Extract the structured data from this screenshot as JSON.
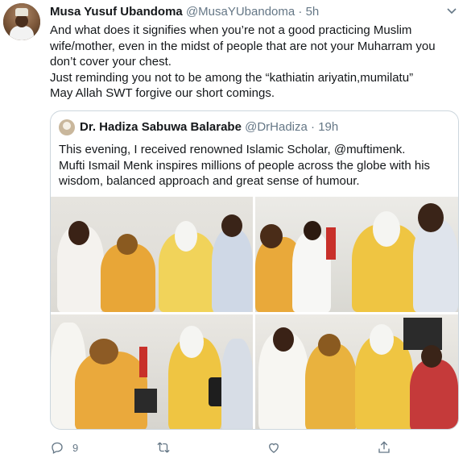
{
  "tweet": {
    "author_name": "Musa Yusuf Ubandoma",
    "handle": "@MusaYUbandoma",
    "separator": "·",
    "time": "5h",
    "body_lines": [
      "And what does it signifies when you’re not a good practicing Muslim",
      "wife/mother, even in the midst of people that are not your Muharram you",
      "don’t cover your chest.",
      "Just reminding you not to be among the “kathiatin ariyatin,mumilatu”",
      "May Allah SWT forgive our short comings."
    ]
  },
  "quoted": {
    "author_name": "Dr. Hadiza Sabuwa Balarabe",
    "handle": "@DrHadiza",
    "separator": "·",
    "time": "19h",
    "body_lines": [
      "This evening, I received renowned Islamic Scholar, @muftimenk.",
      "Mufti Ismail Menk inspires millions of people across the globe with his",
      "wisdom, balanced approach and great sense of humour."
    ]
  },
  "actions": {
    "reply_count": "9",
    "retweet_count": "",
    "like_count": ""
  },
  "icons": [
    "caret-down-icon",
    "reply-icon",
    "retweet-icon",
    "like-icon",
    "share-icon"
  ],
  "colors": {
    "secondary_text": "#657786",
    "border": "#ccd6dd"
  }
}
